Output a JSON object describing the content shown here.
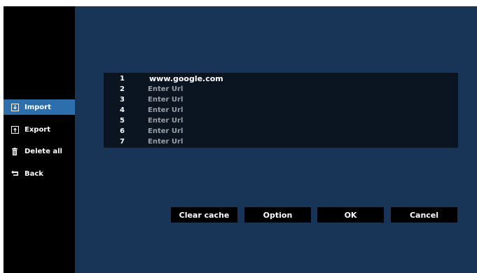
{
  "sidebar": {
    "items": [
      {
        "label": "Import",
        "icon": "import-icon"
      },
      {
        "label": "Export",
        "icon": "export-icon"
      },
      {
        "label": "Delete all",
        "icon": "trash-icon"
      },
      {
        "label": "Back",
        "icon": "back-icon"
      }
    ]
  },
  "url_list": {
    "rows": [
      {
        "num": "1",
        "value": "www.google.com"
      },
      {
        "num": "2",
        "value": "Enter Url"
      },
      {
        "num": "3",
        "value": "Enter Url"
      },
      {
        "num": "4",
        "value": "Enter Url"
      },
      {
        "num": "5",
        "value": "Enter Url"
      },
      {
        "num": "6",
        "value": "Enter Url"
      },
      {
        "num": "7",
        "value": "Enter Url"
      }
    ]
  },
  "buttons": {
    "clear_cache": "Clear cache",
    "option": "Option",
    "ok": "OK",
    "cancel": "Cancel"
  },
  "colors": {
    "main_bg": "#183558",
    "panel_bg": "#0b1521",
    "sidebar_bg": "#000000",
    "active_item": "#2d6fad",
    "placeholder_text": "#9a9fa6"
  }
}
